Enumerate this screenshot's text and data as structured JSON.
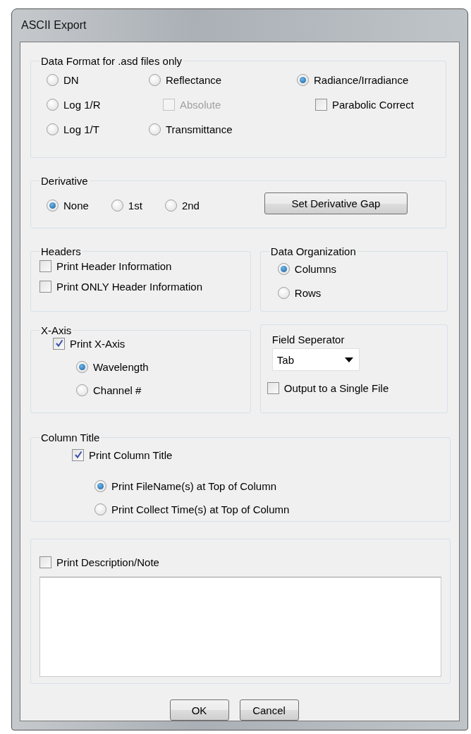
{
  "window": {
    "title": "ASCII Export"
  },
  "data_format": {
    "title": "Data Format for .asd files only",
    "options": [
      {
        "kind": "radio",
        "label": "DN",
        "selected": false,
        "disabled": false
      },
      {
        "kind": "radio",
        "label": "Reflectance",
        "selected": false,
        "disabled": false
      },
      {
        "kind": "radio",
        "label": "Radiance/Irradiance",
        "selected": true,
        "disabled": false
      },
      {
        "kind": "radio",
        "label": "Log 1/R",
        "selected": false,
        "disabled": false
      },
      {
        "kind": "checkbox",
        "label": "Absolute",
        "checked": false,
        "disabled": true
      },
      {
        "kind": "checkbox",
        "label": "Parabolic Correct",
        "checked": false,
        "disabled": false
      },
      {
        "kind": "radio",
        "label": "Log 1/T",
        "selected": false,
        "disabled": false
      },
      {
        "kind": "radio",
        "label": "Transmittance",
        "selected": false,
        "disabled": false
      }
    ]
  },
  "derivative": {
    "title": "Derivative",
    "options": [
      {
        "kind": "radio",
        "label": "None",
        "selected": true
      },
      {
        "kind": "radio",
        "label": "1st",
        "selected": false
      },
      {
        "kind": "radio",
        "label": "2nd",
        "selected": false
      }
    ],
    "button": "Set Derivative Gap"
  },
  "headers": {
    "title": "Headers",
    "options": [
      {
        "kind": "checkbox",
        "label": "Print Header Information",
        "checked": false
      },
      {
        "kind": "checkbox",
        "label": "Print ONLY Header Information",
        "checked": false
      }
    ]
  },
  "data_organization": {
    "title": "Data Organization",
    "options": [
      {
        "kind": "radio",
        "label": "Columns",
        "selected": true
      },
      {
        "kind": "radio",
        "label": "Rows",
        "selected": false
      }
    ]
  },
  "x_axis": {
    "title": "X-Axis",
    "option": {
      "kind": "checkbox",
      "label": "Print X-Axis",
      "checked": true
    },
    "children": [
      {
        "kind": "radio",
        "label": "Wavelength",
        "selected": true
      },
      {
        "kind": "radio",
        "label": "Channel #",
        "selected": false
      }
    ]
  },
  "field_separator": {
    "label": "Field Seperator",
    "value": "Tab",
    "option": {
      "kind": "checkbox",
      "label": "Output to a Single File",
      "checked": false
    }
  },
  "column_title": {
    "title": "Column Title",
    "option": {
      "kind": "checkbox",
      "label": "Print Column Title",
      "checked": true
    },
    "children": [
      {
        "kind": "radio",
        "label": "Print FileName(s) at Top of Column",
        "selected": true
      },
      {
        "kind": "radio",
        "label": "Print Collect Time(s) at Top of Column",
        "selected": false
      }
    ]
  },
  "description": {
    "option": {
      "kind": "checkbox",
      "label": "Print Description/Note",
      "checked": false
    }
  },
  "buttons": [
    "OK",
    "Cancel"
  ]
}
